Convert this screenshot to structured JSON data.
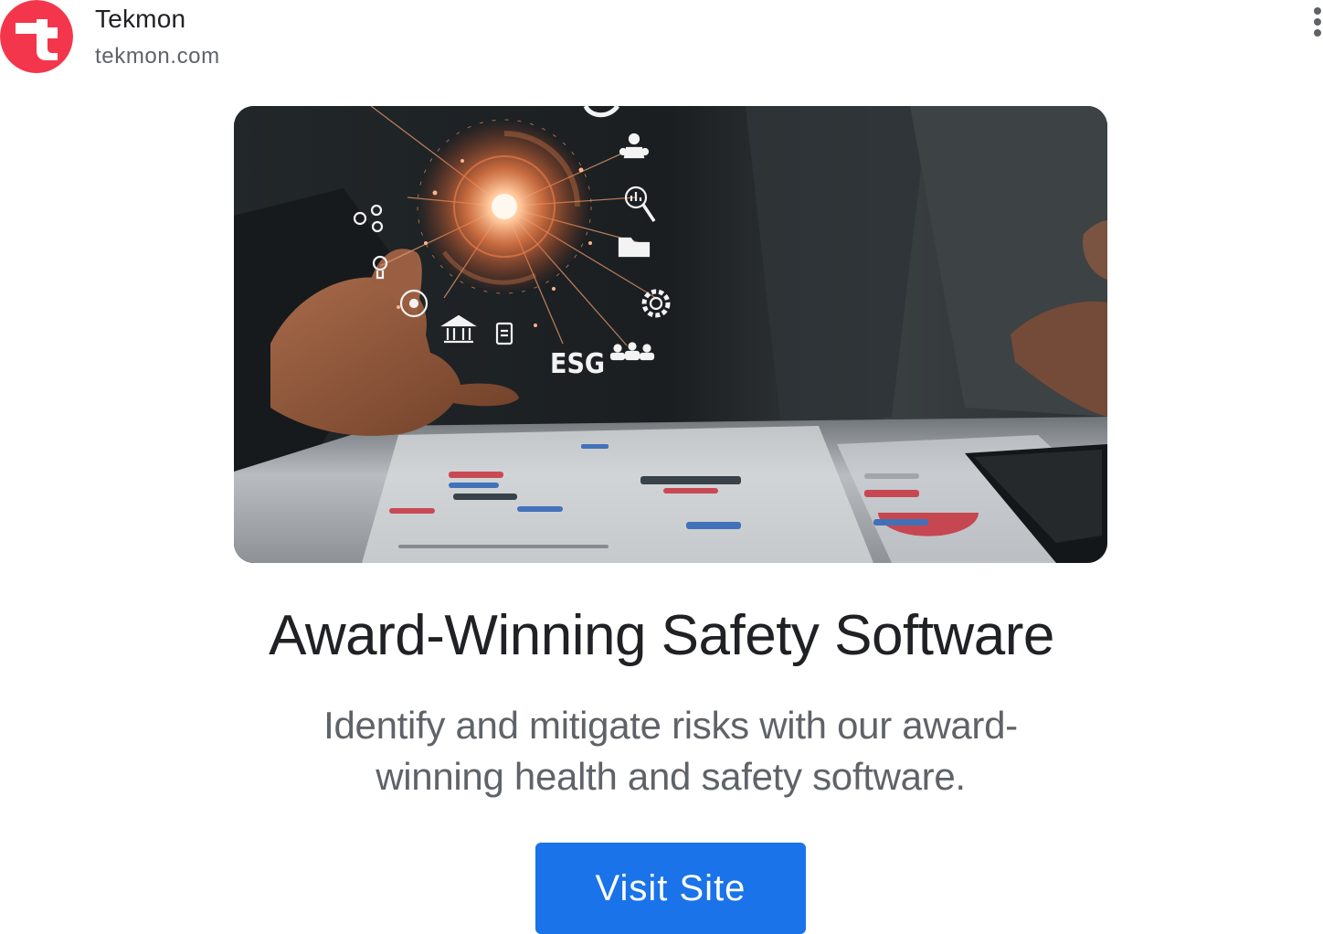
{
  "advertiser": {
    "name": "Tekmon",
    "domain": "tekmon.com",
    "logo_icon": "tekmon-logo-icon",
    "brand_color": "#f4364c"
  },
  "menu": {
    "icon": "more-vert-icon"
  },
  "hero_image": {
    "overlay_text": "ESG",
    "icons": [
      "gears-icon",
      "lightbulb-icon",
      "target-icon",
      "bank-icon",
      "document-icon",
      "team-icon",
      "search-chart-icon",
      "folder-icon",
      "settings-gear-icon",
      "people-icon"
    ]
  },
  "ad": {
    "headline": "Award-Winning Safety Software",
    "description": "Identify and mitigate risks with our award-winning health and safety software.",
    "cta_label": "Visit Site",
    "cta_color": "#1a73e8"
  }
}
